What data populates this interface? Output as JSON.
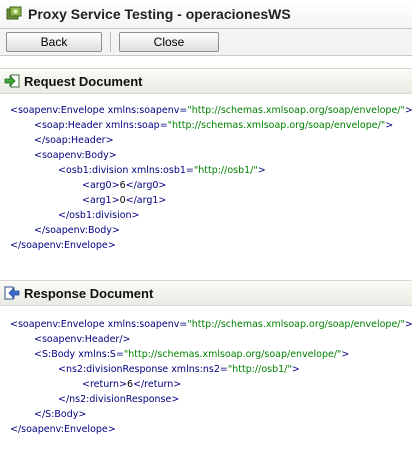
{
  "window": {
    "title": "Proxy Service Testing - operacionesWS"
  },
  "toolbar": {
    "back_label": "Back",
    "close_label": "Close"
  },
  "request": {
    "title": "Request Document",
    "lines": [
      {
        "indent": 0,
        "parts": [
          {
            "t": "tag",
            "v": "<soapenv:Envelope "
          },
          {
            "t": "attr",
            "v": "xmlns:soapenv="
          },
          {
            "t": "val",
            "v": "\"http://schemas.xmlsoap.org/soap/envelope/\""
          },
          {
            "t": "tag",
            "v": ">"
          }
        ]
      },
      {
        "indent": 1,
        "parts": [
          {
            "t": "tag",
            "v": "<soap:Header "
          },
          {
            "t": "attr",
            "v": "xmlns:soap="
          },
          {
            "t": "val",
            "v": "\"http://schemas.xmlsoap.org/soap/envelope/\""
          },
          {
            "t": "tag",
            "v": ">"
          }
        ]
      },
      {
        "indent": 1,
        "parts": [
          {
            "t": "tag",
            "v": "</soap:Header>"
          }
        ]
      },
      {
        "indent": 1,
        "parts": [
          {
            "t": "tag",
            "v": "<soapenv:Body>"
          }
        ]
      },
      {
        "indent": 2,
        "parts": [
          {
            "t": "tag",
            "v": "<osb1:division "
          },
          {
            "t": "attr",
            "v": "xmlns:osb1="
          },
          {
            "t": "val",
            "v": "\"http://osb1/\""
          },
          {
            "t": "tag",
            "v": ">"
          }
        ]
      },
      {
        "indent": 3,
        "parts": [
          {
            "t": "tag",
            "v": "<arg0>"
          },
          {
            "t": "txt",
            "v": "6"
          },
          {
            "t": "tag",
            "v": "</arg0>"
          }
        ]
      },
      {
        "indent": 3,
        "parts": [
          {
            "t": "tag",
            "v": "<arg1>"
          },
          {
            "t": "txt",
            "v": "0"
          },
          {
            "t": "tag",
            "v": "</arg1>"
          }
        ]
      },
      {
        "indent": 2,
        "parts": [
          {
            "t": "tag",
            "v": "</osb1:division>"
          }
        ]
      },
      {
        "indent": 1,
        "parts": [
          {
            "t": "tag",
            "v": "</soapenv:Body>"
          }
        ]
      },
      {
        "indent": 0,
        "parts": [
          {
            "t": "tag",
            "v": "</soapenv:Envelope>"
          }
        ]
      }
    ]
  },
  "response": {
    "title": "Response Document",
    "lines": [
      {
        "indent": 0,
        "parts": [
          {
            "t": "tag",
            "v": "<soapenv:Envelope "
          },
          {
            "t": "attr",
            "v": "xmlns:soapenv="
          },
          {
            "t": "val",
            "v": "\"http://schemas.xmlsoap.org/soap/envelope/\""
          },
          {
            "t": "tag",
            "v": ">"
          }
        ]
      },
      {
        "indent": 1,
        "parts": [
          {
            "t": "tag",
            "v": "<soapenv:Header/>"
          }
        ]
      },
      {
        "indent": 1,
        "parts": [
          {
            "t": "tag",
            "v": "<S:Body "
          },
          {
            "t": "attr",
            "v": "xmlns:S="
          },
          {
            "t": "val",
            "v": "\"http://schemas.xmlsoap.org/soap/envelope/\""
          },
          {
            "t": "tag",
            "v": ">"
          }
        ]
      },
      {
        "indent": 2,
        "parts": [
          {
            "t": "tag",
            "v": "<ns2:divisionResponse "
          },
          {
            "t": "attr",
            "v": "xmlns:ns2="
          },
          {
            "t": "val",
            "v": "\"http://osb1/\""
          },
          {
            "t": "tag",
            "v": ">"
          }
        ]
      },
      {
        "indent": 3,
        "parts": [
          {
            "t": "tag",
            "v": "<return>"
          },
          {
            "t": "txt",
            "v": "6"
          },
          {
            "t": "tag",
            "v": "</return>"
          }
        ]
      },
      {
        "indent": 2,
        "parts": [
          {
            "t": "tag",
            "v": "</ns2:divisionResponse>"
          }
        ]
      },
      {
        "indent": 1,
        "parts": [
          {
            "t": "tag",
            "v": "</S:Body>"
          }
        ]
      },
      {
        "indent": 0,
        "parts": [
          {
            "t": "tag",
            "v": "</soapenv:Envelope>"
          }
        ]
      }
    ]
  },
  "icons": {
    "title": "proxy-service-icon",
    "request": "arrow-in-icon",
    "response": "arrow-out-icon"
  },
  "colors": {
    "tag": "#000080",
    "value": "#008000",
    "header_bg": "#ebebe4"
  }
}
